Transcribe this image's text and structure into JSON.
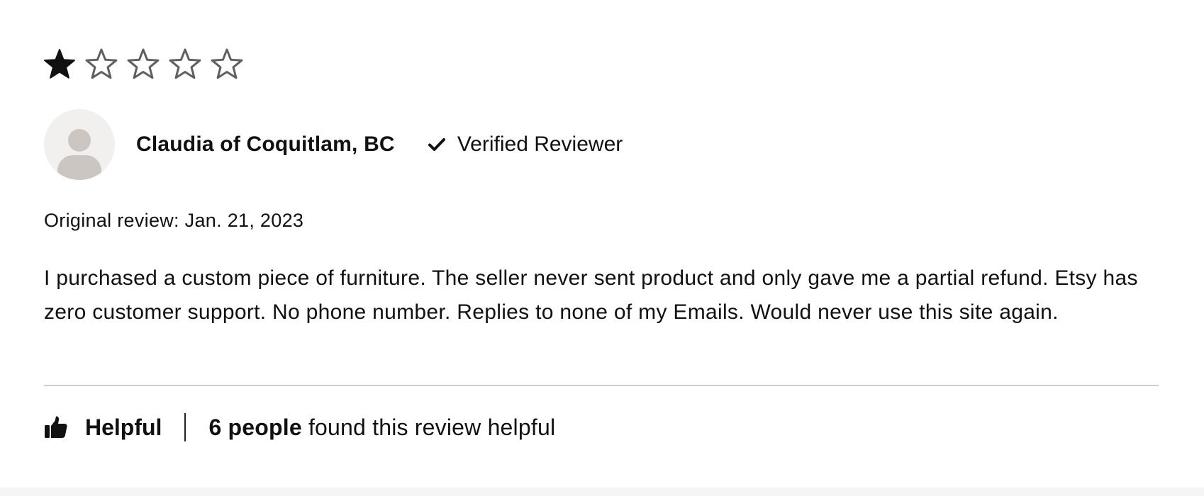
{
  "review": {
    "rating": 1,
    "max_rating": 5,
    "reviewer_name": "Claudia of Coquitlam, BC",
    "verified_label": "Verified Reviewer",
    "original_review": "Original review: Jan. 21, 2023",
    "body": "I purchased a custom piece of furniture. The seller never sent product and only gave me a partial refund. Etsy has zero customer support. No phone number. Replies to none of my Emails. Would never use this site again."
  },
  "footer": {
    "helpful_label": "Helpful",
    "helpful_count": "6 people",
    "helpful_suffix": " found this review helpful"
  },
  "icons": {
    "stars": [
      "star-filled-icon",
      "star-outline-icon",
      "star-outline-icon",
      "star-outline-icon",
      "star-outline-icon"
    ],
    "avatar": "user-avatar-icon",
    "verified": "checkmark-icon",
    "helpful": "thumbs-up-icon"
  },
  "colors": {
    "star_filled": "#111111",
    "star_outline": "#5f5f5f",
    "avatar_bg": "#f2f0ee",
    "avatar_figure": "#cbc6c2",
    "divider": "#cfcfcf",
    "page_bg": "#f5f5f5"
  }
}
